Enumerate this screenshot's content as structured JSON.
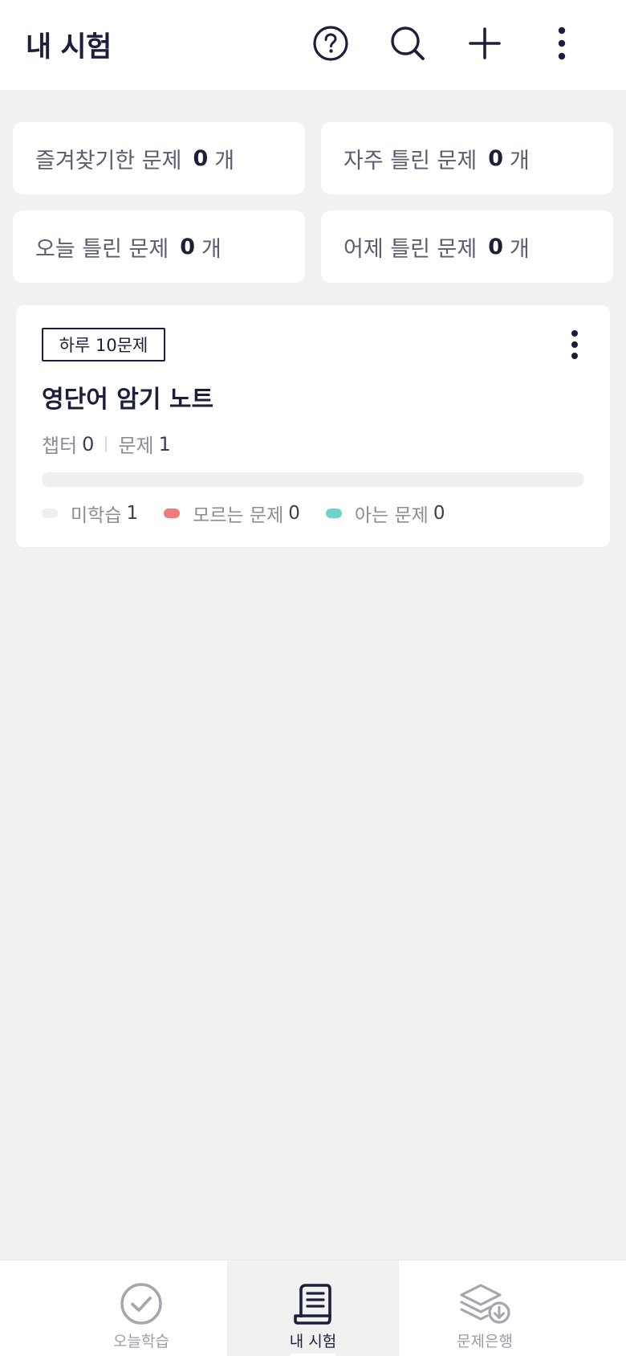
{
  "header": {
    "title": "내 시험",
    "icons": [
      "help-icon",
      "search-icon",
      "plus-icon",
      "more-vertical-icon"
    ]
  },
  "stats": [
    {
      "label": "즐겨찾기한 문제",
      "count": "0",
      "unit": "개"
    },
    {
      "label": "자주 틀린 문제",
      "count": "0",
      "unit": "개"
    },
    {
      "label": "오늘 틀린 문제",
      "count": "0",
      "unit": "개"
    },
    {
      "label": "어제 틀린 문제",
      "count": "0",
      "unit": "개"
    }
  ],
  "exam": {
    "badge": "하루 10문제",
    "title": "영단어 암기 노트",
    "chapter_label": "챕터",
    "chapter_count": "0",
    "question_label": "문제",
    "question_count": "1",
    "progress_known_fraction": 0.0,
    "legend": [
      {
        "label": "미학습",
        "count": "1",
        "color": "#efefef"
      },
      {
        "label": "모르는 문제",
        "count": "0",
        "color": "#f07a7a"
      },
      {
        "label": "아는 문제",
        "count": "0",
        "color": "#6fd3cb"
      }
    ]
  },
  "bottom_nav": {
    "items": [
      {
        "label": "오늘학습",
        "icon": "check-circle-icon",
        "active": false
      },
      {
        "label": "내 시험",
        "icon": "scroll-document-icon",
        "active": true
      },
      {
        "label": "문제은행",
        "icon": "layers-download-icon",
        "active": false
      }
    ]
  },
  "colors": {
    "primary_text": "#1c1f3b",
    "background": "#f1f1f1",
    "unknown": "#f07a7a",
    "known": "#6fd3cb"
  }
}
